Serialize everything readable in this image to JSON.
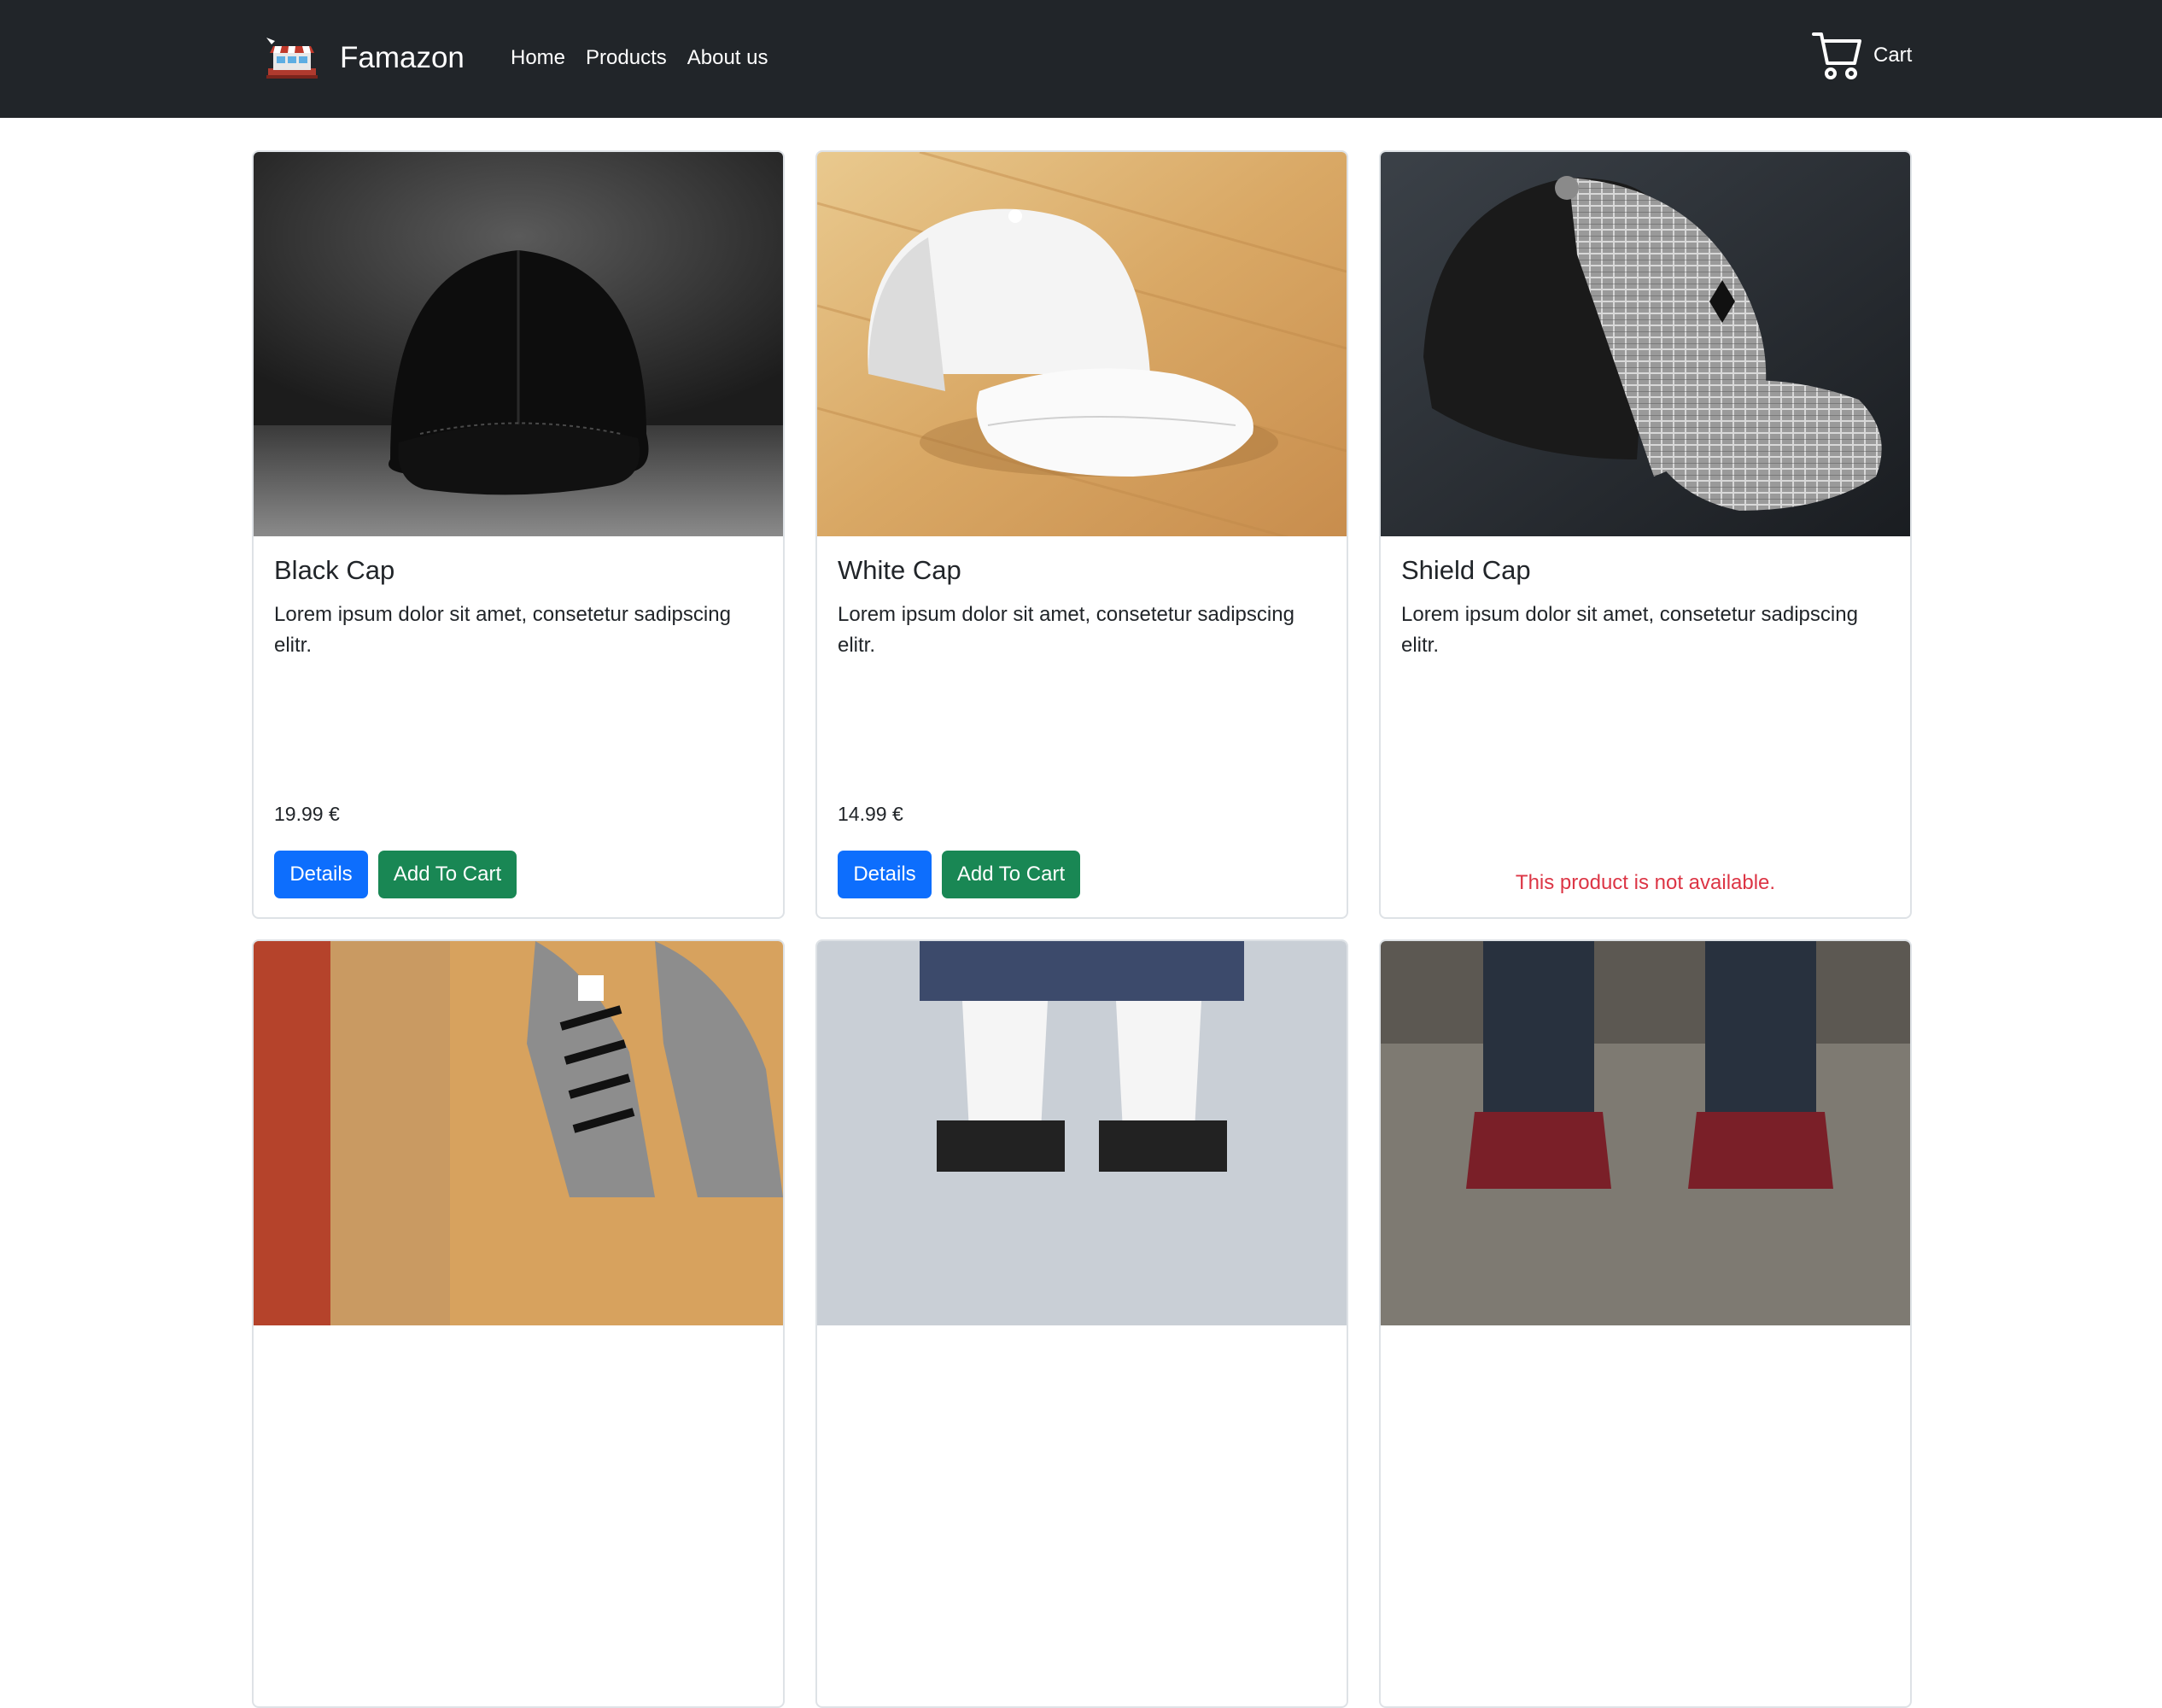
{
  "navbar": {
    "brand": "Famazon",
    "logo_icon": "shop-stall-icon",
    "links": [
      {
        "label": "Home"
      },
      {
        "label": "Products"
      },
      {
        "label": "About us"
      }
    ],
    "cart_label": "Cart",
    "cart_icon": "cart-icon"
  },
  "products": [
    {
      "title": "Black Cap",
      "description": "Lorem ipsum dolor sit amet, consetetur sadipscing elitr.",
      "price": "19.99 €",
      "details_label": "Details",
      "add_to_cart_label": "Add To Cart",
      "available": true
    },
    {
      "title": "White Cap",
      "description": "Lorem ipsum dolor sit amet, consetetur sadipscing elitr.",
      "price": "14.99 €",
      "details_label": "Details",
      "add_to_cart_label": "Add To Cart",
      "available": true
    },
    {
      "title": "Shield Cap",
      "description": "Lorem ipsum dolor sit amet, consetetur sadipscing elitr.",
      "available": false,
      "unavailable_text": "This product is not available."
    }
  ],
  "colors": {
    "navbar_bg": "#212529",
    "primary": "#0d6efd",
    "success": "#198754",
    "danger": "#dc3545"
  }
}
